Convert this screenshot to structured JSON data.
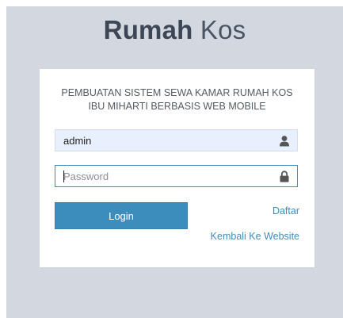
{
  "app": {
    "logo_bold": "Rumah",
    "logo_light": " Kos"
  },
  "card": {
    "title_line1": "PEMBUATAN SISTEM SEWA KAMAR RUMAH KOS",
    "title_line2": "IBU MIHARTI BERBASIS WEB MOBILE"
  },
  "form": {
    "username_value": "admin",
    "username_icon": "user-icon",
    "password_placeholder": "Password",
    "password_icon": "lock-icon",
    "login_label": "Login",
    "register_label": "Daftar",
    "back_label": "Kembali Ke Website"
  },
  "colors": {
    "background": "#d3d8e0",
    "card": "#ffffff",
    "primary": "#3c8dbc",
    "autofill": "#e8f0fe",
    "logo_text": "#3c4654"
  }
}
